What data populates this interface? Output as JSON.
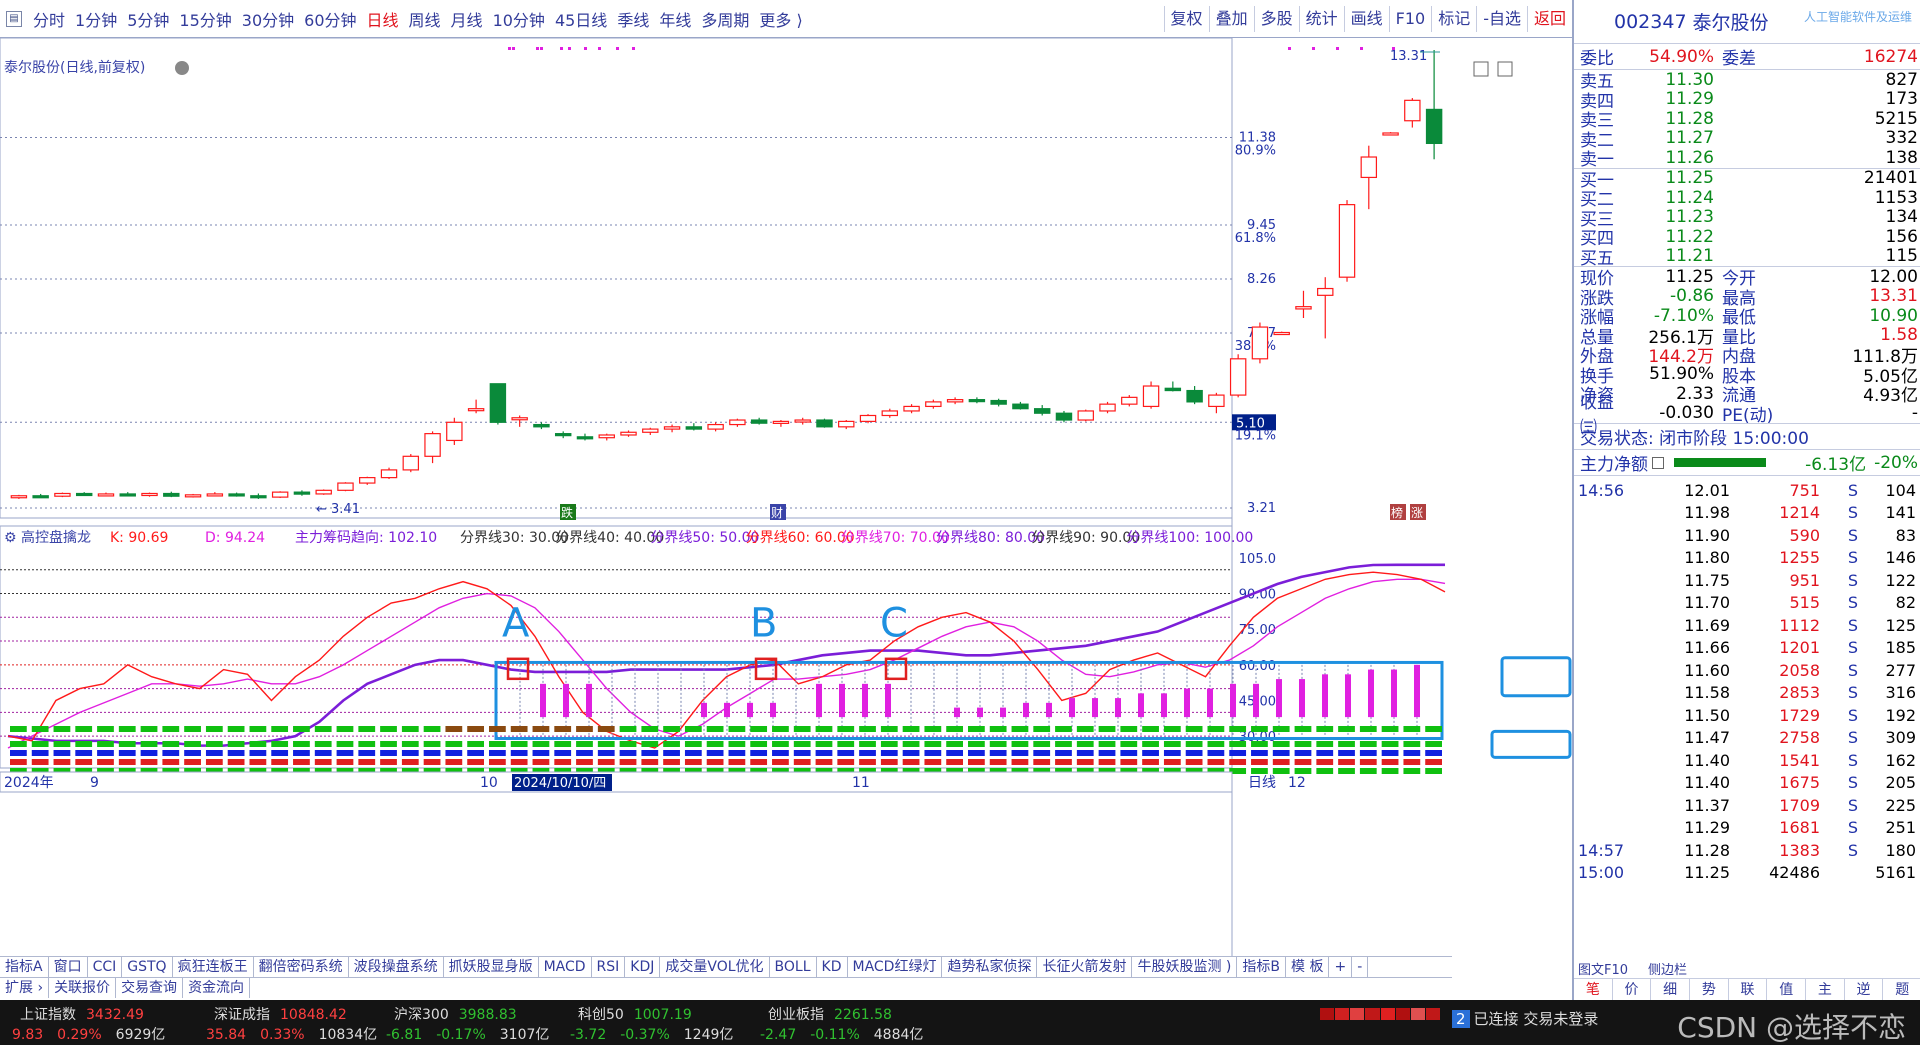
{
  "toolbar": {
    "periods": [
      "分时",
      "1分钟",
      "5分钟",
      "15分钟",
      "30分钟",
      "60分钟",
      "日线",
      "周线",
      "月线",
      "10分钟",
      "45日线",
      "季线",
      "年线",
      "多周期",
      "更多 ⟩"
    ],
    "active_period": "日线",
    "right_buttons": [
      "复权",
      "叠加",
      "多股",
      "统计",
      "画线",
      "F10",
      "标记",
      "-自选",
      "返回"
    ]
  },
  "main_chart": {
    "title": "泰尔股份(日线,前复权)",
    "price_labels": [
      "11.38",
      "80.9%",
      "9.45",
      "61.8%",
      "8.26",
      "7.07",
      "38.2%",
      "5.10",
      "19.1%",
      "3.21"
    ],
    "high_label": "13.31",
    "low_label": "3.41",
    "markers": [
      "跌",
      "财",
      "榜",
      "涨"
    ]
  },
  "indicator": {
    "name": "高控盘擒龙",
    "k_label": "K: 90.69",
    "d_label": "D: 94.24",
    "main_label": "主力筹码趋向: 102.10",
    "lines": [
      "分界线30: 30.00",
      "分界线40: 40.00",
      "分界线50: 50.00",
      "分界线60: 60.00",
      "分界线70: 70.00",
      "分界线80: 80.00",
      "分界线90: 90.00",
      "分界线100: 100.00"
    ],
    "scale": [
      "105.0",
      "90.00",
      "75.00",
      "60.00",
      "45.00",
      "30.00"
    ],
    "annotations": [
      "A",
      "B",
      "C"
    ]
  },
  "time_axis": {
    "labels": [
      "2024年",
      "9",
      "10",
      "2024/10/10/四",
      "11",
      "12"
    ],
    "right": "日线"
  },
  "tabs_row1": [
    "指标A",
    "窗口",
    "CCI",
    "GSTQ",
    "疯狂连板王",
    "翻倍密码系统",
    "波段操盘系统",
    "抓妖股显身版",
    "MACD",
    "RSI",
    "KDJ",
    "成交量VOL优化",
    "BOLL",
    "KD",
    "MACD红绿灯",
    "趋势私家侦探",
    "长征火箭发射",
    "牛股妖股监测 )",
    "指标B",
    "模 板",
    "+",
    "-"
  ],
  "tabs_row2": [
    "扩展 ›",
    "关联报价",
    "交易查询",
    "资金流向"
  ],
  "quote": {
    "code": "002347",
    "name": "泰尔股份",
    "sub": "人工智能软件及运维",
    "weibi_label": "委比",
    "weibi": "54.90%",
    "weicha_label": "委差",
    "weicha": "16274",
    "sells": [
      {
        "label": "卖五",
        "price": "11.30",
        "vol": "827"
      },
      {
        "label": "卖四",
        "price": "11.29",
        "vol": "173"
      },
      {
        "label": "卖三",
        "price": "11.28",
        "vol": "5215"
      },
      {
        "label": "卖二",
        "price": "11.27",
        "vol": "332"
      },
      {
        "label": "卖一",
        "price": "11.26",
        "vol": "138"
      }
    ],
    "buys": [
      {
        "label": "买一",
        "price": "11.25",
        "vol": "21401"
      },
      {
        "label": "买二",
        "price": "11.24",
        "vol": "1153"
      },
      {
        "label": "买三",
        "price": "11.23",
        "vol": "134"
      },
      {
        "label": "买四",
        "price": "11.22",
        "vol": "156"
      },
      {
        "label": "买五",
        "price": "11.21",
        "vol": "115"
      }
    ],
    "stats": [
      {
        "l1": "现价",
        "v1": "11.25",
        "l2": "今开",
        "v2": "12.00"
      },
      {
        "l1": "涨跌",
        "v1": "-0.86",
        "l2": "最高",
        "v2": "13.31"
      },
      {
        "l1": "涨幅",
        "v1": "-7.10%",
        "l2": "最低",
        "v2": "10.90"
      },
      {
        "l1": "总量",
        "v1": "256.1万",
        "l2": "量比",
        "v2": "1.58"
      },
      {
        "l1": "外盘",
        "v1": "144.2万",
        "l2": "内盘",
        "v2": "111.8万"
      },
      {
        "l1": "换手",
        "v1": "51.90%",
        "l2": "股本",
        "v2": "5.05亿"
      },
      {
        "l1": "净资",
        "v1": "2.33",
        "l2": "流通",
        "v2": "4.93亿"
      },
      {
        "l1": "收益㈢",
        "v1": "-0.030",
        "l2": "PE(动)",
        "v2": "-"
      }
    ],
    "trade_status": "交易状态: 闭市阶段 15:00:00",
    "main_net_label": "主力净额",
    "main_net_value": "-6.13亿",
    "main_net_pct": "-20%",
    "ticks": [
      {
        "t": "14:56",
        "p": "12.01",
        "q": "751",
        "s": "S",
        "n": "104"
      },
      {
        "t": "",
        "p": "11.98",
        "q": "1214",
        "s": "S",
        "n": "141"
      },
      {
        "t": "",
        "p": "11.90",
        "q": "590",
        "s": "S",
        "n": "83"
      },
      {
        "t": "",
        "p": "11.80",
        "q": "1255",
        "s": "S",
        "n": "146"
      },
      {
        "t": "",
        "p": "11.75",
        "q": "951",
        "s": "S",
        "n": "122"
      },
      {
        "t": "",
        "p": "11.70",
        "q": "515",
        "s": "S",
        "n": "82"
      },
      {
        "t": "",
        "p": "11.69",
        "q": "1112",
        "s": "S",
        "n": "125"
      },
      {
        "t": "",
        "p": "11.66",
        "q": "1201",
        "s": "S",
        "n": "185"
      },
      {
        "t": "",
        "p": "11.60",
        "q": "2058",
        "s": "S",
        "n": "277"
      },
      {
        "t": "",
        "p": "11.58",
        "q": "2853",
        "s": "S",
        "n": "316"
      },
      {
        "t": "",
        "p": "11.50",
        "q": "1729",
        "s": "S",
        "n": "192"
      },
      {
        "t": "",
        "p": "11.47",
        "q": "2758",
        "s": "S",
        "n": "309"
      },
      {
        "t": "",
        "p": "11.40",
        "q": "1541",
        "s": "S",
        "n": "162"
      },
      {
        "t": "",
        "p": "11.40",
        "q": "1675",
        "s": "S",
        "n": "205"
      },
      {
        "t": "",
        "p": "11.37",
        "q": "1709",
        "s": "S",
        "n": "225"
      },
      {
        "t": "",
        "p": "11.29",
        "q": "1681",
        "s": "S",
        "n": "251"
      },
      {
        "t": "14:57",
        "p": "11.28",
        "q": "1383",
        "s": "S",
        "n": "180"
      },
      {
        "t": "15:00",
        "p": "11.25",
        "q": "42486",
        "s": "",
        "n": "5161"
      }
    ],
    "bottom_tabs": [
      "笔",
      "价",
      "细",
      "势",
      "联",
      "值",
      "主",
      "逆",
      "题"
    ],
    "f10_label": "图文F10",
    "side_label": "侧边栏"
  },
  "status_bar": {
    "indices": [
      {
        "name": "上证指数",
        "value": "3432.49",
        "chg": "9.83",
        "pct": "0.29%",
        "amt": "6929亿",
        "up": true
      },
      {
        "name": "深证成指",
        "value": "10848.42",
        "chg": "35.84",
        "pct": "0.33%",
        "amt": "10834亿",
        "up": true
      },
      {
        "name": "沪深300",
        "value": "3988.83",
        "chg": "-6.81",
        "pct": "-0.17%",
        "amt": "3107亿",
        "up": false
      },
      {
        "name": "科创50",
        "value": "1007.19",
        "chg": "-3.72",
        "pct": "-0.37%",
        "amt": "1249亿",
        "up": false
      },
      {
        "name": "创业板指",
        "value": "2261.58",
        "chg": "-2.47",
        "pct": "-0.11%",
        "amt": "4884亿",
        "up": false
      }
    ],
    "connected_num": "2",
    "connected": "已连接 交易未登录",
    "watermark": "CSDN @选择不恋"
  },
  "chart_data": {
    "type": "candlestick",
    "note_title": "泰尔股份(日线,前复权)",
    "ohlc": [
      [
        3.45,
        3.5,
        3.41,
        3.48
      ],
      [
        3.48,
        3.52,
        3.44,
        3.47
      ],
      [
        3.47,
        3.55,
        3.45,
        3.53
      ],
      [
        3.53,
        3.56,
        3.48,
        3.5
      ],
      [
        3.5,
        3.55,
        3.47,
        3.52
      ],
      [
        3.52,
        3.56,
        3.48,
        3.49
      ],
      [
        3.49,
        3.55,
        3.46,
        3.53
      ],
      [
        3.53,
        3.57,
        3.45,
        3.47
      ],
      [
        3.47,
        3.52,
        3.44,
        3.5
      ],
      [
        3.5,
        3.56,
        3.47,
        3.52
      ],
      [
        3.52,
        3.55,
        3.46,
        3.48
      ],
      [
        3.48,
        3.53,
        3.41,
        3.45
      ],
      [
        3.45,
        3.58,
        3.43,
        3.56
      ],
      [
        3.56,
        3.6,
        3.48,
        3.52
      ],
      [
        3.52,
        3.62,
        3.5,
        3.6
      ],
      [
        3.6,
        3.78,
        3.58,
        3.76
      ],
      [
        3.76,
        3.9,
        3.72,
        3.88
      ],
      [
        3.88,
        4.1,
        3.85,
        4.05
      ],
      [
        4.05,
        4.4,
        4.0,
        4.35
      ],
      [
        4.35,
        4.9,
        4.2,
        4.85
      ],
      [
        4.7,
        5.2,
        4.6,
        5.1
      ],
      [
        5.4,
        5.6,
        5.3,
        5.4
      ],
      [
        5.95,
        5.95,
        5.05,
        5.1
      ],
      [
        5.2,
        5.25,
        5.0,
        5.2
      ],
      [
        5.05,
        5.1,
        4.95,
        5.0
      ],
      [
        4.85,
        4.9,
        4.75,
        4.82
      ],
      [
        4.78,
        4.85,
        4.7,
        4.75
      ],
      [
        4.76,
        4.85,
        4.7,
        4.82
      ],
      [
        4.82,
        4.92,
        4.78,
        4.88
      ],
      [
        4.88,
        4.98,
        4.82,
        4.95
      ],
      [
        4.95,
        5.05,
        4.88,
        5.0
      ],
      [
        5.0,
        5.08,
        4.92,
        4.95
      ],
      [
        4.95,
        5.1,
        4.9,
        5.05
      ],
      [
        5.05,
        5.18,
        5.0,
        5.15
      ],
      [
        5.15,
        5.2,
        5.05,
        5.08
      ],
      [
        5.08,
        5.15,
        5.0,
        5.12
      ],
      [
        5.12,
        5.2,
        5.05,
        5.15
      ],
      [
        5.15,
        5.18,
        4.98,
        5.0
      ],
      [
        5.0,
        5.15,
        4.95,
        5.12
      ],
      [
        5.12,
        5.28,
        5.08,
        5.25
      ],
      [
        5.25,
        5.4,
        5.2,
        5.35
      ],
      [
        5.35,
        5.5,
        5.3,
        5.45
      ],
      [
        5.45,
        5.6,
        5.4,
        5.55
      ],
      [
        5.55,
        5.65,
        5.5,
        5.6
      ],
      [
        5.6,
        5.65,
        5.52,
        5.58
      ],
      [
        5.58,
        5.62,
        5.45,
        5.5
      ],
      [
        5.5,
        5.55,
        5.38,
        5.4
      ],
      [
        5.4,
        5.48,
        5.25,
        5.3
      ],
      [
        5.3,
        5.35,
        5.1,
        5.15
      ],
      [
        5.15,
        5.38,
        5.12,
        5.35
      ],
      [
        5.35,
        5.55,
        5.3,
        5.5
      ],
      [
        5.5,
        5.7,
        5.45,
        5.65
      ],
      [
        5.45,
        6.0,
        5.4,
        5.9
      ],
      [
        5.85,
        6.0,
        5.78,
        5.8
      ],
      [
        5.8,
        5.9,
        5.5,
        5.55
      ],
      [
        5.45,
        5.75,
        5.3,
        5.7
      ],
      [
        5.7,
        6.6,
        5.65,
        6.5
      ],
      [
        6.5,
        7.3,
        6.4,
        7.2
      ],
      [
        7.05,
        7.1,
        7.05,
        7.08
      ],
      [
        7.6,
        8.0,
        7.4,
        7.65
      ],
      [
        7.9,
        8.3,
        6.95,
        8.05
      ],
      [
        8.3,
        10.0,
        8.2,
        9.9
      ],
      [
        10.5,
        11.2,
        9.8,
        10.95
      ],
      [
        11.45,
        11.5,
        11.45,
        11.48
      ],
      [
        11.75,
        12.25,
        11.6,
        12.2
      ],
      [
        12.0,
        13.31,
        10.9,
        11.25
      ]
    ],
    "ylim": [
      3.21,
      13.31
    ],
    "kdj": {
      "k": [
        30,
        28,
        45,
        50,
        52,
        60,
        55,
        52,
        50,
        58,
        56,
        45,
        55,
        62,
        72,
        80,
        86,
        88,
        92,
        95,
        92,
        85,
        72,
        55,
        40,
        32,
        28,
        25,
        32,
        45,
        55,
        60,
        62,
        52,
        55,
        60,
        62,
        70,
        76,
        80,
        82,
        78,
        70,
        58,
        45,
        48,
        58,
        62,
        65,
        60,
        55,
        68,
        80,
        88,
        92,
        96,
        98,
        99,
        98,
        96,
        90.69
      ],
      "d": [
        25,
        30,
        35,
        40,
        44,
        48,
        52,
        52,
        51,
        52,
        54,
        52,
        52,
        55,
        60,
        66,
        72,
        78,
        84,
        88,
        90,
        89,
        84,
        74,
        62,
        50,
        40,
        33,
        30,
        35,
        42,
        48,
        54,
        54,
        55,
        56,
        58,
        62,
        67,
        72,
        76,
        78,
        76,
        70,
        62,
        56,
        55,
        57,
        60,
        61,
        59,
        62,
        68,
        76,
        82,
        88,
        92,
        95,
        96,
        96,
        94.24
      ],
      "main": [
        30,
        29,
        28,
        28,
        28,
        27,
        27,
        27,
        26,
        26,
        27,
        28,
        30,
        36,
        45,
        52,
        56,
        60,
        62,
        62,
        60,
        58,
        57,
        57,
        57,
        57,
        58,
        58,
        58,
        58,
        58,
        59,
        60,
        62,
        64,
        65,
        66,
        66,
        66,
        65,
        64,
        64,
        65,
        66,
        67,
        68,
        70,
        72,
        74,
        78,
        82,
        86,
        90,
        94,
        97,
        99,
        101,
        102,
        102.1,
        102.1,
        102.1
      ],
      "bars": [
        0,
        50,
        50,
        50,
        0,
        0,
        0,
        0,
        42,
        42,
        42,
        42,
        0,
        50,
        50,
        50,
        50,
        0,
        0,
        40,
        40,
        40,
        42,
        42,
        44,
        44,
        44,
        46,
        46,
        48,
        48,
        50,
        50,
        52,
        52,
        54,
        54,
        56,
        56,
        58
      ]
    }
  }
}
